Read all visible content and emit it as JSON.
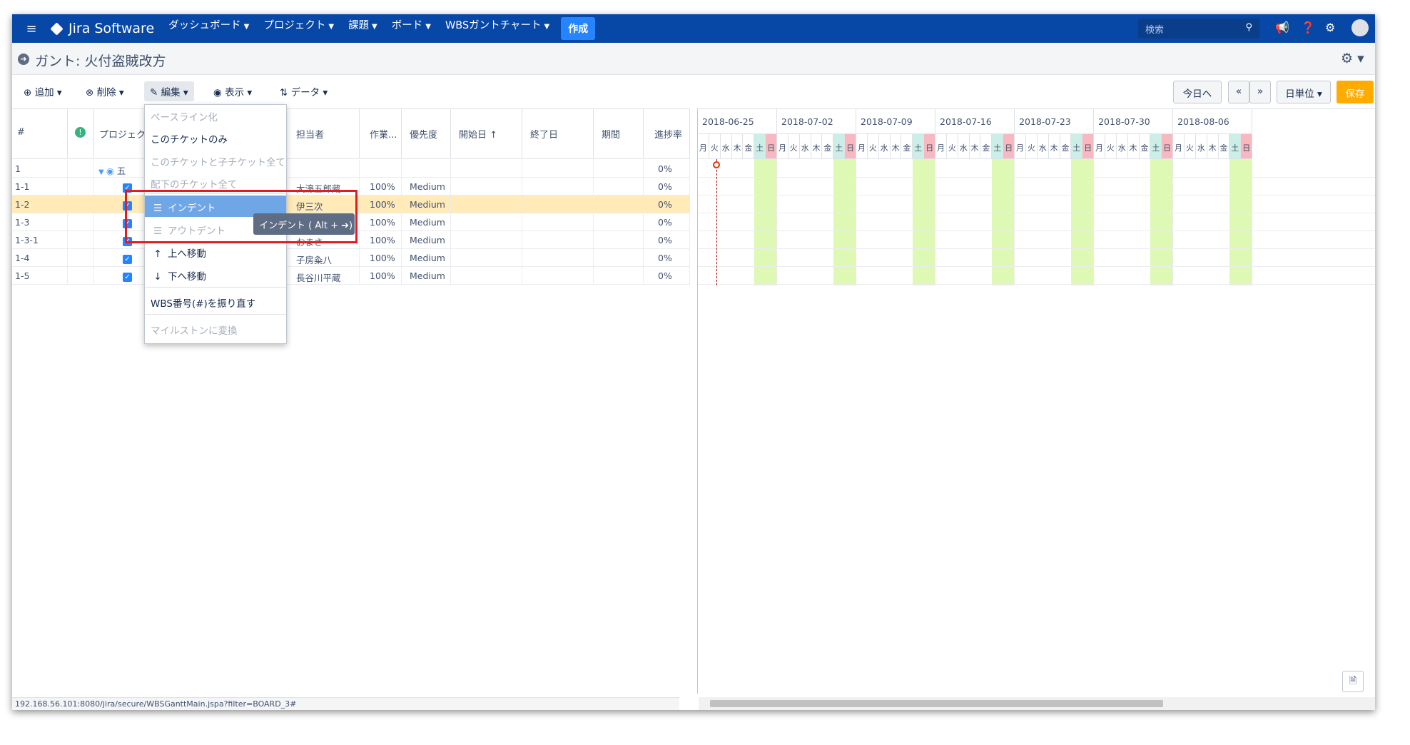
{
  "nav": {
    "logo": "Jira Software",
    "menu": [
      "ダッシュボード",
      "プロジェクト",
      "課題",
      "ボード",
      "WBSガントチャート"
    ],
    "create": "作成",
    "search_placeholder": "検索"
  },
  "title": "ガント: 火付盗賊改方",
  "toolbar": {
    "add": "追加",
    "delete": "削除",
    "edit": "編集",
    "view": "表示",
    "data": "データ",
    "today": "今日へ",
    "prev": "«",
    "next": "»",
    "unit": "日単位",
    "save": "保存"
  },
  "grid": {
    "headers": [
      "#",
      "",
      "プロジェク",
      "担当者",
      "作業...",
      "優先度",
      "開始日 ↑",
      "終了日",
      "期間",
      "進捗率"
    ],
    "rows": [
      {
        "wbs": "1",
        "name": "五",
        "assignee": "",
        "work": "",
        "priority": "",
        "progress": "0%"
      },
      {
        "wbs": "1-1",
        "name": "",
        "assignee": "大濠五郎蔵",
        "work": "100%",
        "priority": "Medium",
        "progress": "0%"
      },
      {
        "wbs": "1-2",
        "name": "",
        "assignee": "伊三次",
        "work": "100%",
        "priority": "Medium",
        "progress": "0%"
      },
      {
        "wbs": "1-3",
        "name": "",
        "assignee": "",
        "work": "100%",
        "priority": "Medium",
        "progress": "0%"
      },
      {
        "wbs": "1-3-1",
        "name": "",
        "assignee": "おまさ",
        "work": "100%",
        "priority": "Medium",
        "progress": "0%"
      },
      {
        "wbs": "1-4",
        "name": "",
        "assignee": "子房粂八",
        "work": "100%",
        "priority": "Medium",
        "progress": "0%"
      },
      {
        "wbs": "1-5",
        "name": "",
        "assignee": "長谷川平蔵",
        "work": "100%",
        "priority": "Medium",
        "progress": "0%"
      }
    ]
  },
  "gantt": {
    "weeks": [
      "2018-06-25",
      "2018-07-02",
      "2018-07-09",
      "2018-07-16",
      "2018-07-23",
      "2018-07-30",
      "2018-08-06"
    ],
    "days": [
      "月",
      "火",
      "水",
      "木",
      "金",
      "土",
      "日"
    ]
  },
  "dropdown": {
    "items": [
      {
        "label": "ベースライン化",
        "disabled": true
      },
      {
        "label": "このチケットのみ",
        "disabled": false
      },
      {
        "label": "このチケットと子チケット全て",
        "disabled": true
      },
      {
        "label": "配下のチケット全て",
        "disabled": true
      },
      {
        "label": "インデント",
        "disabled": false,
        "highlighted": true,
        "icon": "indent-icon"
      },
      {
        "label": "アウトデント",
        "disabled": true,
        "icon": "outdent-icon"
      },
      {
        "label": "上へ移動",
        "disabled": false,
        "icon": "move-up-icon"
      },
      {
        "label": "下へ移動",
        "disabled": false,
        "icon": "move-down-icon"
      },
      {
        "label": "WBS番号(#)を振り直す",
        "disabled": false
      },
      {
        "label": "マイルストンに変換",
        "disabled": true
      }
    ],
    "tooltip": "インデント ( Alt + ➔)"
  },
  "status_url": "192.168.56.101:8080/jira/secure/WBSGanttMain.jspa?filter=BOARD_3#",
  "colors": {
    "nav": "#0747a6",
    "accent": "#2684ff",
    "save": "#ffab00",
    "weekend": "#ddf9b4",
    "selected_row": "#ffeab8"
  }
}
